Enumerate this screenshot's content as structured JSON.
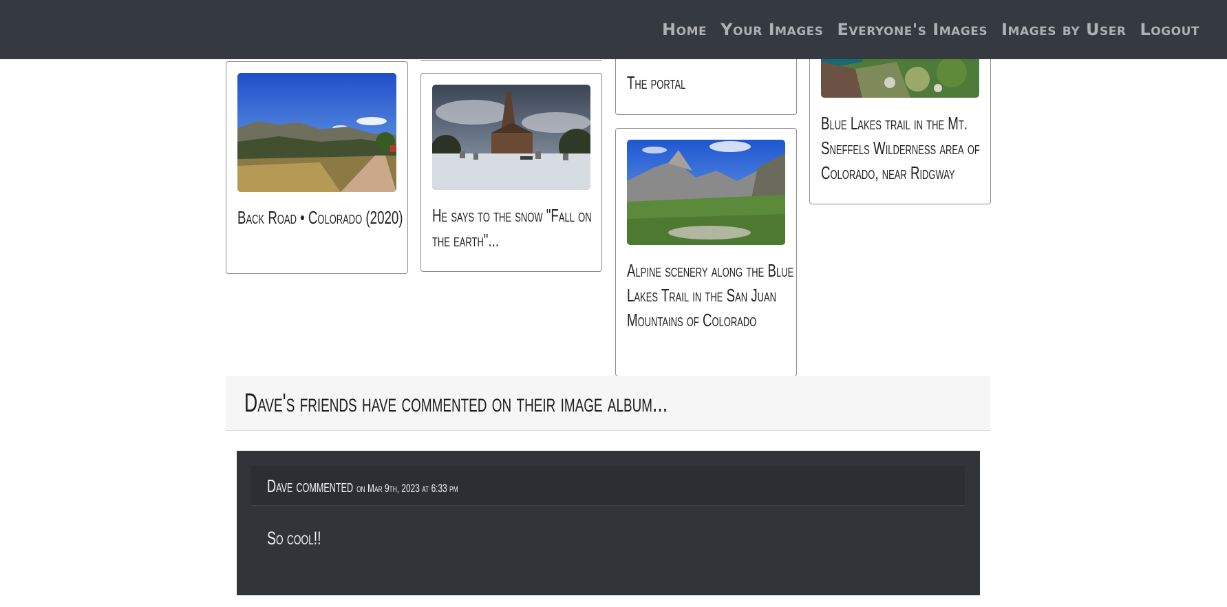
{
  "nav": {
    "home": "Home",
    "your_images": "Your Images",
    "everyones_images": "Everyone's Images",
    "images_by_user": "Images by User",
    "logout": "Logout"
  },
  "gallery": {
    "cards": [
      {
        "caption": "Back Road • Colorado (2020)",
        "image": "mountain-road-photo"
      },
      {
        "caption": "He says to the snow \"Fall on the earth\"...",
        "image": "church-snow-cemetery-photo"
      },
      {
        "caption": "The portal",
        "image": "none-visible"
      },
      {
        "caption": "Alpine scenery along the Blue Lakes Trail in the San Juan Mountains of Colorado",
        "image": "alpine-valley-photo"
      },
      {
        "caption": "Blue Lakes trail in the Mt. Sneffels Wilderness area of Colorado, near Ridgway",
        "image": "blue-lake-rocks-photo"
      }
    ]
  },
  "comments": {
    "header": "Dave's friends have commented on their image album...",
    "items": [
      {
        "author": "Dave commented",
        "date": "on Mar 9th, 2023 at 6:33 pm",
        "text": "So cool!!"
      }
    ]
  }
}
